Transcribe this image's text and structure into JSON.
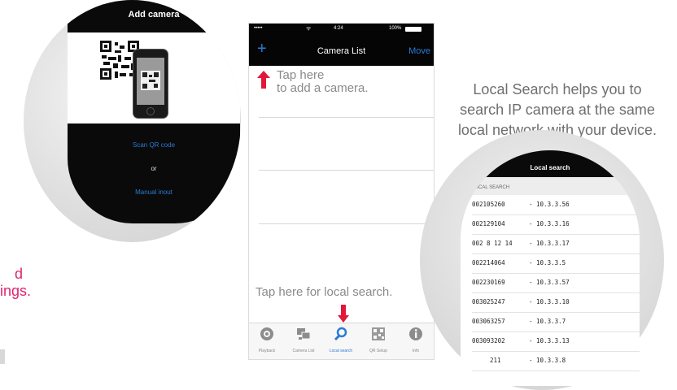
{
  "add_camera_screen": {
    "title": "Add camera",
    "scan_qr": "Scan QR code",
    "or": "or",
    "manual_input": "Manual inout"
  },
  "left_caption": {
    "line1": "d",
    "line2": "ings."
  },
  "camera_list_screen": {
    "status": {
      "carrier": "•••••",
      "wifi": "ᯤ",
      "time": "4:24",
      "battery": "100%"
    },
    "nav": {
      "add": "+",
      "title": "Camera List",
      "move": "Move"
    },
    "hint_add_line1": "Tap here",
    "hint_add_line2": "to add a camera.",
    "hint_search": "Tap here for local search.",
    "tabs": [
      {
        "label": "Playback",
        "icon": "playback-icon"
      },
      {
        "label": "Camera List",
        "icon": "camera-list-icon"
      },
      {
        "label": "Local search",
        "icon": "search-icon"
      },
      {
        "label": "QR Setup",
        "icon": "qr-icon"
      },
      {
        "label": "Info",
        "icon": "info-icon"
      }
    ]
  },
  "right_caption": {
    "line1": "Local Search helps you to",
    "line2": "search IP camera at the same",
    "line3": "local network with your device."
  },
  "local_search_screen": {
    "title": "Local search",
    "section": "LOCAL SEARCH",
    "rows": [
      {
        "id": "002105260",
        "ip": "- 10.3.3.56"
      },
      {
        "id": "002129104",
        "ip": "- 10.3.3.16"
      },
      {
        "id": "002 8 12 14",
        "ip": "- 10.3.3.17"
      },
      {
        "id": "002214064",
        "ip": "- 10.3.3.5"
      },
      {
        "id": "002230169",
        "ip": "- 10.3.3.57"
      },
      {
        "id": "003025247",
        "ip": "- 10.3.3.10"
      },
      {
        "id": "003063257",
        "ip": "- 10.3.3.7"
      },
      {
        "id": "003093202",
        "ip": "- 10.3.3.13"
      },
      {
        "id": "211",
        "ip": "- 10.3.3.8"
      }
    ]
  },
  "colors": {
    "accent_blue": "#2a7bd4",
    "arrow_red": "#e2183b",
    "pink": "#e0246c"
  }
}
